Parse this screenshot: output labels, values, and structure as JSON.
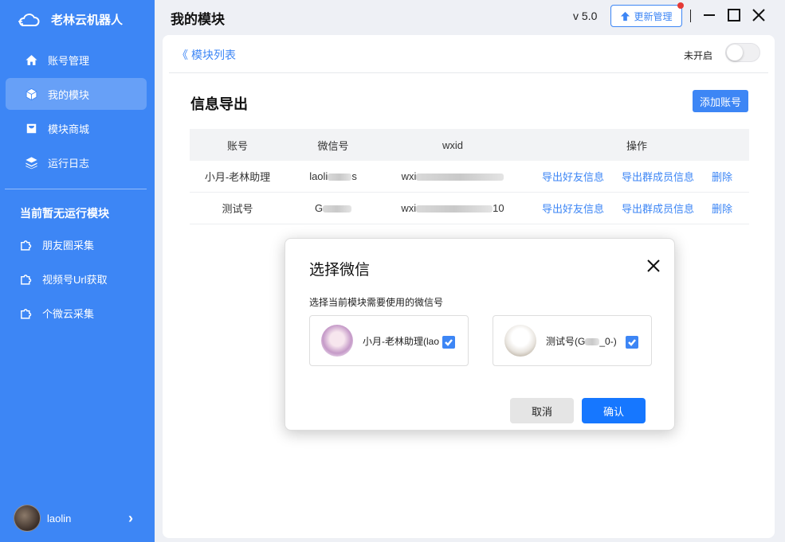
{
  "app": {
    "name": "老林云机器人",
    "page_title": "我的模块",
    "version": "v 5.0",
    "update_label": "更新管理"
  },
  "sidebar": {
    "items": [
      {
        "label": "账号管理",
        "icon": "home-icon"
      },
      {
        "label": "我的模块",
        "icon": "cube-icon",
        "active": true
      },
      {
        "label": "模块商城",
        "icon": "bag-icon"
      },
      {
        "label": "运行日志",
        "icon": "layers-icon"
      }
    ],
    "section_title": "当前暂无运行模块",
    "modules": [
      {
        "label": "朋友圈采集",
        "icon": "puzzle-icon"
      },
      {
        "label": "视频号Url获取",
        "icon": "puzzle-icon"
      },
      {
        "label": "个微云采集",
        "icon": "puzzle-icon"
      }
    ],
    "user": {
      "name": "laolin"
    }
  },
  "main": {
    "back_label": "模块列表",
    "toggle_label": "未开启",
    "toggle_on": false,
    "section_title": "信息导出",
    "add_button": "添加账号",
    "table": {
      "headers": [
        "账号",
        "微信号",
        "wxid",
        "操作"
      ],
      "rows": [
        {
          "account": "小月-老林助理",
          "wechat_prefix": "laoli",
          "wechat_suffix": "s",
          "wxid_prefix": "wxi",
          "wxid_suffix": "",
          "actions": [
            "导出好友信息",
            "导出群成员信息",
            "删除"
          ]
        },
        {
          "account": "测试号",
          "wechat_prefix": "G",
          "wechat_suffix": "",
          "wxid_prefix": "wxi",
          "wxid_suffix": "10",
          "actions": [
            "导出好友信息",
            "导出群成员信息",
            "删除"
          ]
        }
      ]
    }
  },
  "dialog": {
    "title": "选择微信",
    "subtitle": "选择当前模块需要使用的微信号",
    "accounts": [
      {
        "label": "小月-老林助理(lao",
        "checked": true
      },
      {
        "label": "测试号(G",
        "label_suffix": "_0-)",
        "checked": true
      }
    ],
    "cancel_label": "取消",
    "confirm_label": "确认"
  },
  "colors": {
    "accent": "#3d86f5",
    "primary_button": "#1677ff",
    "notification_dot": "#e53935"
  }
}
